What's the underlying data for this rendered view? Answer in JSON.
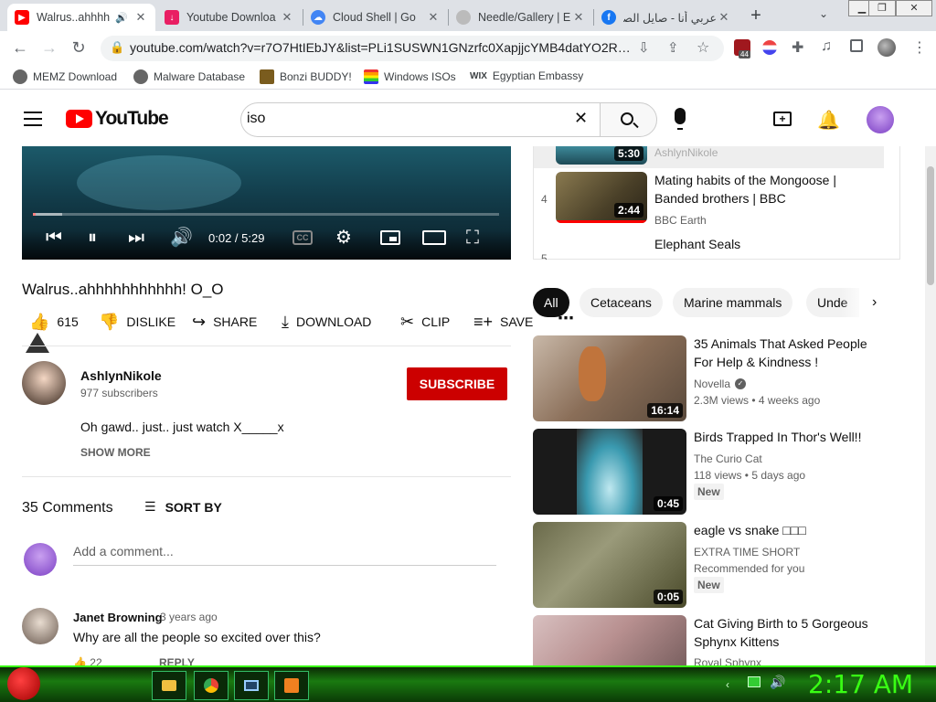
{
  "browser": {
    "tabs": [
      {
        "title": "Walrus..ahhhh",
        "active": true
      },
      {
        "title": "Youtube Downloa"
      },
      {
        "title": "Cloud Shell | Go"
      },
      {
        "title": "Needle/Gallery | E"
      },
      {
        "title": "عربي أنا - صايل الصر"
      }
    ],
    "new_tab": "+",
    "url": "youtube.com/watch?v=r7O7HtIEbJY&list=PLi1SUSWN1GNzrfc0XapjjcYMB4datYO2R&i...",
    "extension_badge": "44",
    "bookmarks": [
      "MEMZ Download",
      "Malware Database",
      "Bonzi BUDDY!",
      "Windows ISOs",
      "Egyptian Embassy"
    ]
  },
  "youtube": {
    "logo": "YouTube",
    "search_value": "iso",
    "video": {
      "title": "Walrus..ahhhhhhhhhhh! O_O",
      "time": "0:02 / 5:29",
      "progress": 0.006,
      "likes": "615",
      "dislike": "DISLIKE",
      "share": "SHARE",
      "download": "DOWNLOAD",
      "clip": "CLIP",
      "save": "SAVE"
    },
    "channel": {
      "name": "AshlynNikole",
      "subscribers": "977 subscribers",
      "subscribe": "SUBSCRIBE",
      "description": "Oh gawd.. just.. just watch X_____x",
      "show_more": "SHOW MORE"
    },
    "comments": {
      "count": "35 Comments",
      "sort": "SORT BY",
      "placeholder": "Add a comment...",
      "first": {
        "author": "Janet Browning",
        "age": "3 years ago",
        "text": "Why are all the people so excited over this?",
        "likes": "22",
        "reply": "REPLY"
      }
    },
    "playlist": [
      {
        "index": "",
        "duration": "5:30",
        "title": "",
        "channel": "AshlynNikole"
      },
      {
        "index": "4",
        "duration": "2:44",
        "title": "Mating habits of the Mongoose | Banded brothers | BBC",
        "channel": "BBC Earth"
      },
      {
        "index": "5",
        "title": "Elephant Seals"
      }
    ],
    "chips": [
      "All",
      "Cetaceans",
      "Marine mammals",
      "Unde"
    ],
    "recommended": [
      {
        "title": "35 Animals That Asked People For Help & Kindness !",
        "channel": "Novella",
        "meta": "2.3M views • 4 weeks ago",
        "duration": "16:14",
        "badge": ""
      },
      {
        "title": "Birds Trapped In Thor's Well!!",
        "channel": "The Curio Cat",
        "meta": "118 views • 5 days ago",
        "duration": "0:45",
        "badge": "New"
      },
      {
        "title": "eagle vs snake □□□",
        "channel": "EXTRA TIME SHORT",
        "meta": "Recommended for you",
        "duration": "0:05",
        "badge": "New"
      },
      {
        "title": "Cat Giving Birth to 5 Gorgeous Sphynx Kittens",
        "channel": "Royal Sphynx",
        "meta": "",
        "duration": "",
        "badge": ""
      }
    ]
  },
  "taskbar": {
    "clock": "2:17 AM"
  }
}
